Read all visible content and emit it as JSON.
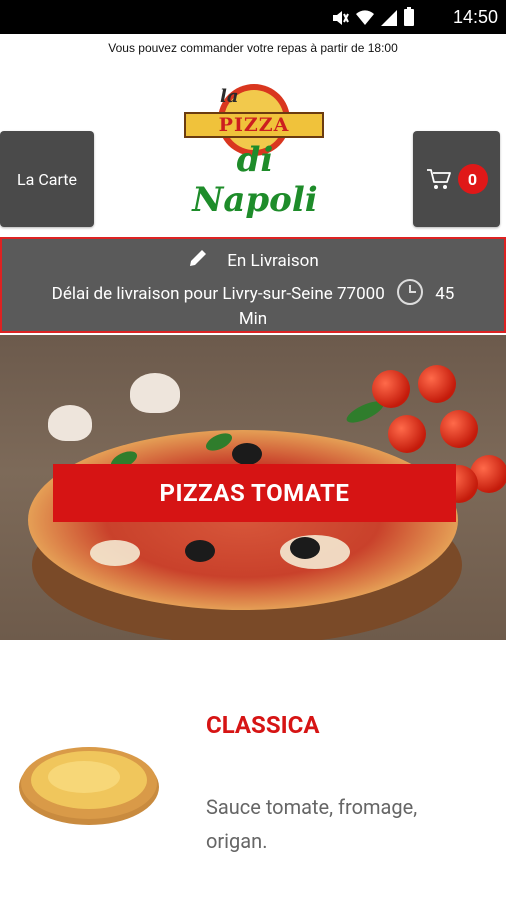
{
  "status_bar": {
    "time": "14:50",
    "icons": [
      "mute-icon",
      "wifi-icon",
      "signal-icon",
      "battery-icon"
    ]
  },
  "notice": "Vous pouvez commander votre repas à partir de 18:00",
  "header": {
    "menu_button_label": "La Carte",
    "cart_count": "0",
    "logo": {
      "top": "la",
      "ribbon": "PIZZA",
      "bottom": "di Napoli"
    }
  },
  "delivery": {
    "mode": "En Livraison",
    "delay_text": "Délai de livraison pour Livry-sur-Seine 77000",
    "delay_value": "45",
    "delay_unit": "Min"
  },
  "category": {
    "title": "PIZZAS TOMATE"
  },
  "product": {
    "name": "CLASSICA",
    "description": "Sauce tomate, fromage, origan."
  },
  "colors": {
    "accent": "#d61414",
    "dark_button": "#4a4a4a",
    "banner_bg": "#5a5a5a",
    "logo_green": "#1e8c2a",
    "logo_gold": "#f0c23b"
  }
}
